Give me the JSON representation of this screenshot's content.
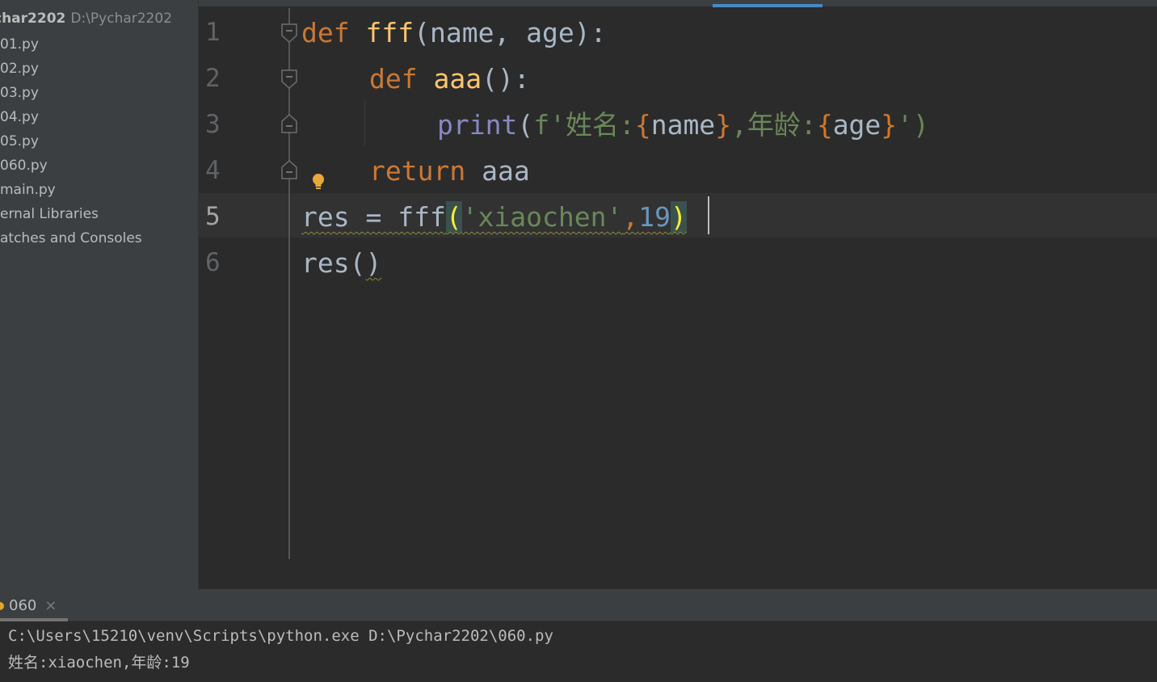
{
  "project": {
    "name": "char2202",
    "path": "D:\\Pychar2202",
    "items": [
      "01.py",
      "02.py",
      "03.py",
      "04.py",
      "05.py",
      "060.py",
      "main.py",
      "ernal Libraries",
      "atches and Consoles"
    ]
  },
  "editor": {
    "line_numbers": [
      "1",
      "2",
      "3",
      "4",
      "5",
      "6"
    ],
    "active_line": "5",
    "code": {
      "l1": {
        "kw": "def",
        "fn": "fff",
        "rest": "(name, age):"
      },
      "l2": {
        "kw": "def",
        "fn": "aaa",
        "rest": "():"
      },
      "l3": {
        "bi": "print",
        "p1": "(",
        "f": "f'姓名:",
        "b1": "{",
        "v1": "name",
        "b2": "}",
        "mid": ",年龄:",
        "b3": "{",
        "v2": "age",
        "b4": "}",
        "end": "')"
      },
      "l4": {
        "kw": "return",
        "rest": "aaa"
      },
      "l5": {
        "a": "res = fff",
        "po": "(",
        "str": "'xiaochen'",
        "comma": ",",
        "num": "19",
        "pc": ")"
      },
      "l6": {
        "a": "res(",
        "b": ")"
      }
    }
  },
  "run": {
    "tab_label": "060",
    "close_symbol": "×",
    "console_lines": [
      "C:\\Users\\15210\\venv\\Scripts\\python.exe D:\\Pychar2202\\060.py",
      "姓名:xiaochen,年龄:19"
    ]
  },
  "icons": {
    "fold": "fold-marker-icon",
    "bulb": "lightbulb-icon",
    "close": "close-icon"
  },
  "colors": {
    "keyword": "#cc7832",
    "function": "#ffc66d",
    "builtin": "#8888c6",
    "string": "#6a8759",
    "number": "#6897bb",
    "text": "#a9b7c6",
    "background": "#2b2b2b",
    "sidebar": "#3c3f41"
  }
}
